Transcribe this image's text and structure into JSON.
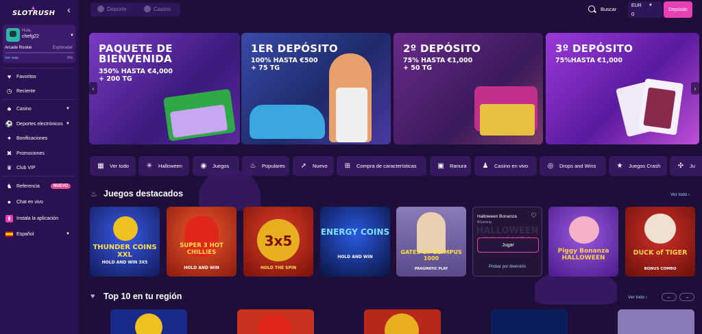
{
  "brand": {
    "logo": "SLOTRUSH"
  },
  "user": {
    "greeting": "Hola,",
    "name": "chefg22",
    "rank": "Arcade Rookie",
    "next_rank": "Explorador",
    "progress_percent": 0,
    "progress_label": "0%",
    "more_link": "Ver más"
  },
  "sidebar": {
    "items": [
      {
        "label": "Favoritos",
        "icon": "heart-icon"
      },
      {
        "label": "Reciente",
        "icon": "clock-icon"
      },
      {
        "label": "Casino",
        "icon": "casino-icon"
      },
      {
        "label": "Deportes electrónicos",
        "icon": "esports-icon"
      },
      {
        "label": "Bonificaciones",
        "icon": "bonus-icon"
      },
      {
        "label": "Promociones",
        "icon": "promo-icon"
      },
      {
        "label": "Club VIP",
        "icon": "crown-icon"
      },
      {
        "label": "Referencia",
        "icon": "referral-icon",
        "badge": "NUEVO"
      },
      {
        "label": "Chat en vivo",
        "icon": "chat-icon"
      },
      {
        "label": "Instala la aplicación",
        "icon": "app-icon"
      },
      {
        "label": "Español",
        "icon": "flag-icon"
      }
    ]
  },
  "topbar": {
    "tabs": [
      "Deporte",
      "Casino"
    ],
    "search_label": "Buscar",
    "currency": "EUR",
    "balance": "0",
    "deposit_label": "Depósito"
  },
  "banners": [
    {
      "title_lines": [
        "PAQUETE DE",
        "BIENVENIDA"
      ],
      "sub_lines": [
        "350% HASTA €4,000",
        "+ 200 TG"
      ],
      "bg": "#6b2fb0"
    },
    {
      "title_lines": [
        "1ER DEPÓSITO"
      ],
      "sub_lines": [
        "100% HASTA €500",
        "+ 75 TG"
      ],
      "bg": "#2f3d8c"
    },
    {
      "title_lines": [
        "2º DEPÓSITO"
      ],
      "sub_lines": [
        "75% HASTA €1,000",
        "+ 50 TG"
      ],
      "bg": "#5b1f7a"
    },
    {
      "title_lines": [
        "3º DEPÓSITO"
      ],
      "sub_lines": [
        "75%HASTA €1,000"
      ],
      "bg": "#7a2cb8"
    }
  ],
  "categories": [
    {
      "label": "Ver todo",
      "icon": "grid-icon"
    },
    {
      "label": "Halloween",
      "icon": "spider-icon"
    },
    {
      "label": "Juegos",
      "icon": "gamepad-icon"
    },
    {
      "label": "Populares",
      "icon": "fire-icon"
    },
    {
      "label": "Nuevo",
      "icon": "rocket-icon"
    },
    {
      "label": "Compra de características",
      "icon": "controller-icon"
    },
    {
      "label": "Ranura",
      "icon": "slot-icon"
    },
    {
      "label": "Casino en vivo",
      "icon": "live-icon"
    },
    {
      "label": "Drops and Wins",
      "icon": "drops-icon"
    },
    {
      "label": "Juegos Crash",
      "icon": "star-icon"
    },
    {
      "label": "Ju",
      "icon": "puzzle-icon"
    }
  ],
  "featured": {
    "title": "Juegos destacados",
    "see_all": "Ver todo",
    "games": [
      {
        "name": "THUNDER COINS XXL",
        "sub": "HOLD AND WIN 3X5",
        "bg": "#1a2a8a"
      },
      {
        "name": "SUPER 3 HOT CHILLIES",
        "sub": "HOLD AND WIN",
        "bg": "#c8321e"
      },
      {
        "name": "3x5",
        "sub": "HOLD THE SPIN",
        "bg": "#b8281a"
      },
      {
        "name": "ENERGY COINS",
        "sub": "HOLD AND WIN",
        "bg": "#0b1e5a"
      },
      {
        "name": "GATES OF OLYMPUS 1000",
        "sub": "PRAGMATIC PLAY",
        "bg": "#7a6aa0"
      },
      {
        "name": "HALLOWEEN BONANZA",
        "sub": "",
        "bg": "#2a1a40"
      },
      {
        "name": "Piggy Bonanza HALLOWEEN",
        "sub": "",
        "bg": "#6a3aa8"
      },
      {
        "name": "DUCK of TIGER",
        "sub": "BONUS COMBO",
        "bg": "#9a2a1a"
      }
    ],
    "hover_card": {
      "title": "Halloween Bonanza",
      "provider": "BGaming",
      "play_label": "Jugar",
      "demo_label": "Probar por diversión"
    }
  },
  "top10": {
    "title": "Top 10 en tu región",
    "see_all": "Ver todo"
  },
  "colors": {
    "accent": "#e83fb4",
    "bg": "#1e0e3a",
    "sidebar": "#2a1150",
    "pill": "#34195f"
  }
}
